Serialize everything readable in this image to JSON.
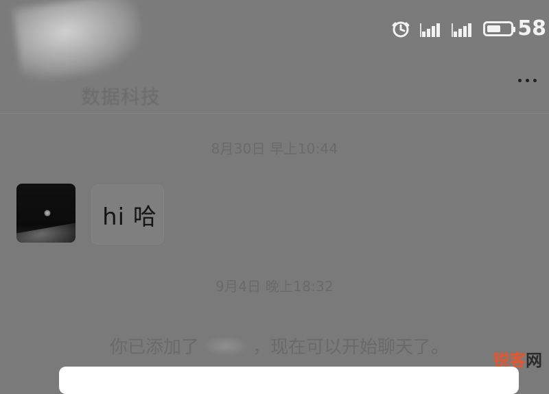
{
  "status": {
    "battery_text": "58",
    "battery_level_percent": 58,
    "icons": [
      "alarm-icon",
      "signal-icon",
      "signal-icon",
      "battery-icon"
    ]
  },
  "chat": {
    "title": "数据科技",
    "timestamps": [
      "8月30日 早上10:44",
      "9月4日 晚上18:32"
    ],
    "message": {
      "text": "hi 哈"
    },
    "system": {
      "prefix": "你已添加了",
      "suffix": "，现在可以开始聊天了。"
    }
  },
  "watermark": {
    "part1": "锐客",
    "part2": "网"
  },
  "colors": {
    "watermark_primary": "#e4572e",
    "watermark_secondary": "#2b2b2b"
  }
}
